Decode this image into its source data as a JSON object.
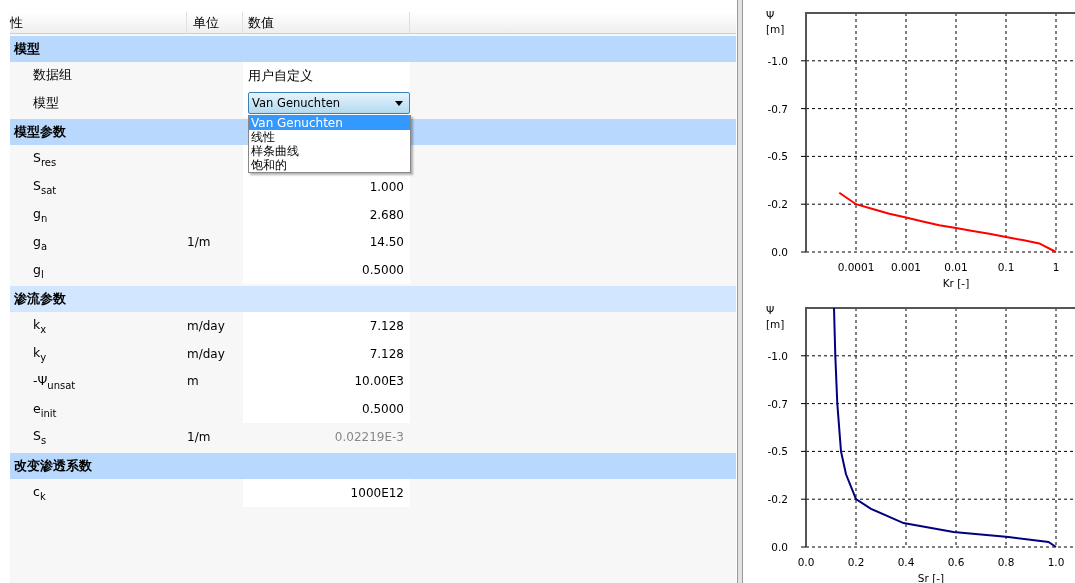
{
  "table": {
    "columns": [
      "性",
      "单位",
      "数值"
    ],
    "rows": [
      {
        "kind": "group",
        "label": "模型",
        "hovered": false
      },
      {
        "kind": "text",
        "name": "数据组",
        "value": "用户自定义"
      },
      {
        "kind": "dropdown",
        "name": "模型",
        "value": "Van Genuchten",
        "expanded": true,
        "options": [
          {
            "label": "Van Genuchten",
            "selected": true
          },
          {
            "label": "线性",
            "selected": false
          },
          {
            "label": "样条曲线",
            "selected": false
          },
          {
            "label": "饱和的",
            "selected": false
          }
        ]
      },
      {
        "kind": "group",
        "label": "模型参数",
        "hovered": false
      },
      {
        "kind": "number",
        "name": "S$_{res}$"
      },
      {
        "kind": "number",
        "name": "S$_{sat}$",
        "value": "1.000",
        "disabled": false
      },
      {
        "kind": "number",
        "name": "g$_{n}$",
        "value": "2.680",
        "disabled": false
      },
      {
        "kind": "number",
        "name": "g$_{a}$",
        "unit": "1/m",
        "value": "14.50",
        "disabled": false
      },
      {
        "kind": "number",
        "name": "g$_{l}$",
        "value": "0.5000",
        "disabled": false
      },
      {
        "kind": "group",
        "label": "渗流参数",
        "hovered": true
      },
      {
        "kind": "number",
        "name": "k$_{x}$",
        "unit": "m/day",
        "value": "7.128",
        "disabled": false
      },
      {
        "kind": "number",
        "name": "k$_{y}$",
        "unit": "m/day",
        "value": "7.128",
        "disabled": false
      },
      {
        "kind": "number",
        "name": "-Ψ$_{unsat}$",
        "unit": "m",
        "value": "10.00E3",
        "disabled": false
      },
      {
        "kind": "number",
        "name": "e$_{init}$",
        "value": "0.5000",
        "disabled": false
      },
      {
        "kind": "number",
        "name": "S$_{s}$",
        "unit": "1/m",
        "value": "0.02219E-3",
        "disabled": true
      },
      {
        "kind": "group",
        "label": "改变渗透系数",
        "hovered": false
      },
      {
        "kind": "number",
        "name": "c$_{k}$",
        "value": "1000E12",
        "disabled": false
      }
    ]
  },
  "charts": [
    {
      "chart_data": {
        "type": "line",
        "xlabel": "Kr [-]",
        "ylabel": "Ψ [m]",
        "grid": true,
        "ylim": [
          0,
          -1.25
        ],
        "categories": [
          null,
          "0.0001",
          null,
          null,
          "0.001",
          null,
          null,
          "0.01",
          null,
          null,
          "0.1",
          null,
          null,
          "1"
        ],
        "yticks": [
          {
            "value": -1.0,
            "label": "-1.0"
          },
          {
            "value": -0.75,
            "label": "-0.7"
          },
          {
            "value": -0.5,
            "label": "-0.5"
          },
          {
            "value": -0.25,
            "label": "-0.2"
          },
          {
            "value": 0,
            "label": "0.0"
          }
        ],
        "series": [
          {
            "color": "#ff0000",
            "values": [
              -0.31,
              -0.25,
              -0.225,
              -0.2,
              -0.18,
              -0.16,
              -0.14,
              -0.125,
              -0.11,
              -0.095,
              -0.078,
              -0.062,
              -0.045,
              0
            ]
          }
        ]
      }
    },
    {
      "chart_data": {
        "type": "line",
        "xlabel": "Sr [-]",
        "ylabel": "Ψ [m]",
        "grid": true,
        "xlim": [
          0,
          1.08
        ],
        "ylim": [
          0,
          -1.25
        ],
        "xticks": [
          {
            "value": 0,
            "label": "0.0"
          },
          {
            "value": 0.2,
            "label": "0.2"
          },
          {
            "value": 0.4,
            "label": "0.4"
          },
          {
            "value": 0.6,
            "label": "0.6"
          },
          {
            "value": 0.8,
            "label": "0.8"
          },
          {
            "value": 1,
            "label": "1.0"
          }
        ],
        "yticks": [
          {
            "value": -1.0,
            "label": "-1.0"
          },
          {
            "value": -0.75,
            "label": "-0.7"
          },
          {
            "value": -0.5,
            "label": "-0.5"
          },
          {
            "value": -0.25,
            "label": "-0.2"
          },
          {
            "value": 0,
            "label": "0.0"
          }
        ],
        "x": [
          0.112,
          0.117,
          0.125,
          0.14,
          0.16,
          0.2,
          0.26,
          0.39,
          0.59,
          0.81,
          0.97,
          1.0
        ],
        "series": [
          {
            "color": "#000080",
            "values": [
              -1.25,
              -1.0,
              -0.75,
              -0.5,
              -0.38,
              -0.25,
              -0.2,
              -0.125,
              -0.078,
              -0.052,
              -0.026,
              0
            ]
          }
        ]
      }
    }
  ]
}
